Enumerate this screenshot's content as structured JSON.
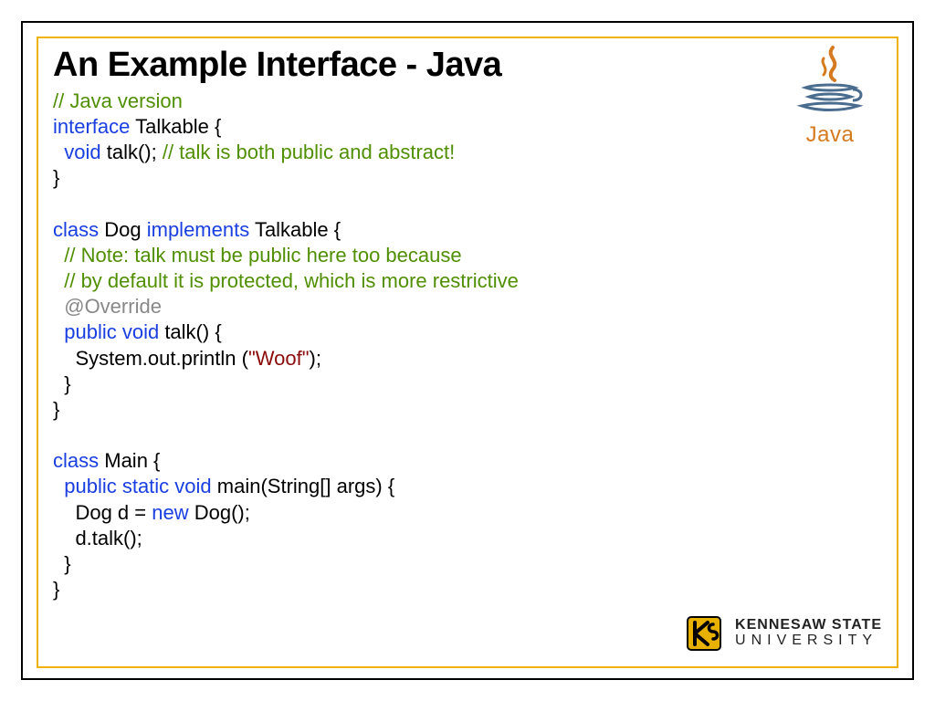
{
  "title": "An Example Interface - Java",
  "code": {
    "l1": "// Java version",
    "l2a": "interface ",
    "l2b": "Talkable {",
    "l3a": "void ",
    "l3b": "talk(); ",
    "l3c": "// talk is both public and abstract!",
    "l4": "}",
    "l6a": "class ",
    "l6b": "Dog ",
    "l6c": "implements ",
    "l6d": "Talkable {",
    "l7": "// Note: talk must be public here too because",
    "l8": "// by default it is protected, which is more restrictive",
    "l9": "@Override",
    "l10a": "public void ",
    "l10b": "talk() {",
    "l11a": "    System.out.println (",
    "l11b": "\"Woof\"",
    "l11c": ");",
    "l12": "  }",
    "l13": "}",
    "l15a": "class ",
    "l15b": "Main {",
    "l16a": "public static void ",
    "l16b": "main(String[] args) {",
    "l17a": "    Dog d = ",
    "l17b": "new ",
    "l17c": "Dog();",
    "l18": "    d.talk();",
    "l19": "  }",
    "l20": "}"
  },
  "javaLogo": {
    "word": "Java"
  },
  "ksu": {
    "line1": "KENNESAW STATE",
    "line2": "UNIVERSITY"
  }
}
